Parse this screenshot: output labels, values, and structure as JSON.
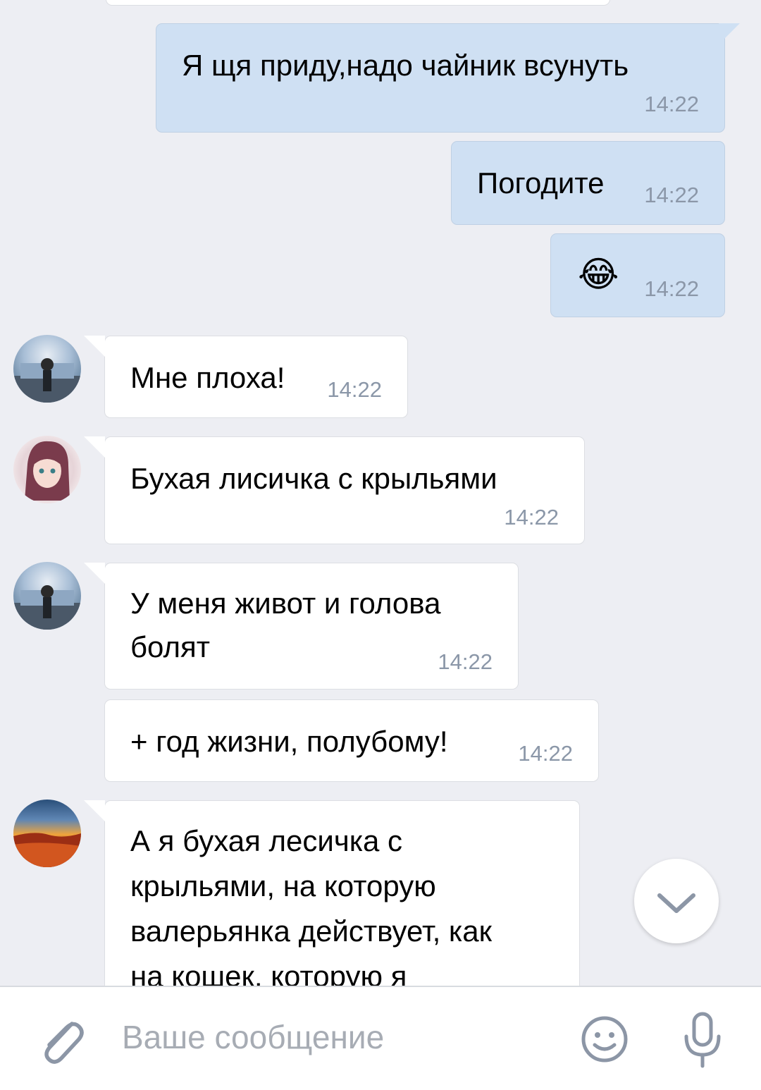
{
  "messages": [
    {
      "id": "m1",
      "direction": "outgoing",
      "text": "Я щя приду,надо чайник всунуть",
      "time": "14:22"
    },
    {
      "id": "m2",
      "direction": "outgoing",
      "text": "Погодите",
      "time": "14:22"
    },
    {
      "id": "m3",
      "direction": "outgoing",
      "text": "😂",
      "time": "14:22"
    },
    {
      "id": "m4",
      "direction": "incoming",
      "avatar": "fountain-photo",
      "text": "Мне плоха!",
      "time": "14:22"
    },
    {
      "id": "m5",
      "direction": "incoming",
      "avatar": "anime-girl",
      "text": "Бухая лисичка с крыльями",
      "time": "14:22"
    },
    {
      "id": "m6",
      "direction": "incoming",
      "avatar": "fountain-photo",
      "lines": [
        "У меня живот и голова",
        "болят"
      ],
      "time": "14:22"
    },
    {
      "id": "m7",
      "direction": "incoming",
      "text": "+ год жизни, полубому!",
      "time": "14:22"
    },
    {
      "id": "m8",
      "direction": "incoming",
      "avatar": "sunset-landscape",
      "lines": [
        "А я бухая лесичка с",
        "крыльями, на которую",
        "валерьянка действует, как",
        "на кошек, которую я"
      ]
    }
  ],
  "composer": {
    "placeholder": "Ваше сообщение",
    "icons": {
      "attach": "paperclip-icon",
      "emoji": "smiley-icon",
      "voice": "microphone-icon"
    }
  },
  "scroll_button": {
    "icon": "chevron-down-icon"
  },
  "colors": {
    "background": "#edeef3",
    "outgoing_bubble": "#cfe0f3",
    "incoming_bubble": "#ffffff",
    "time": "#8b97a8",
    "icon": "#8c96a6"
  }
}
